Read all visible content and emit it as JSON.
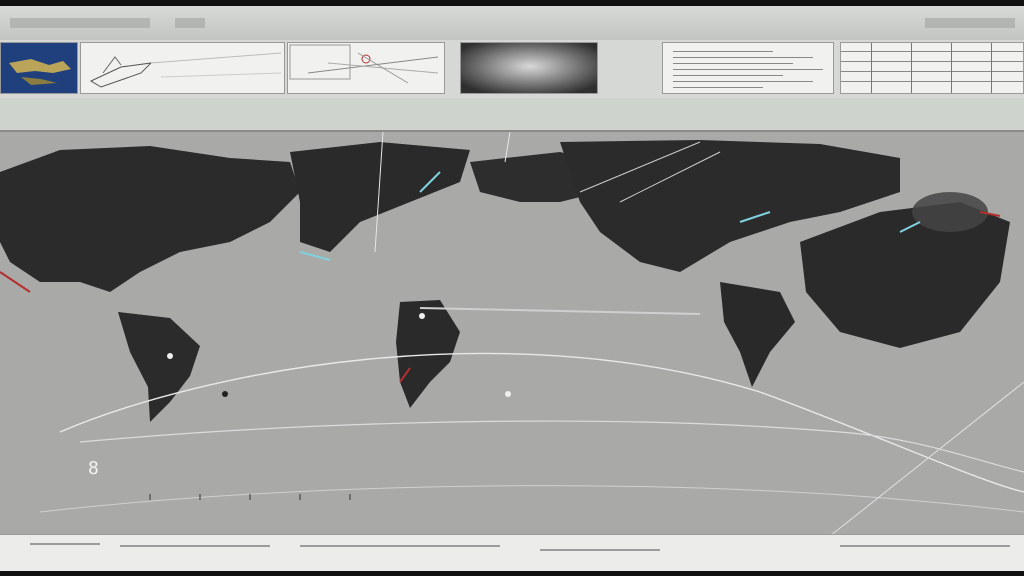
{
  "window": {
    "title": ""
  },
  "thumbnails": [
    {
      "name": "thumb-satellite-map"
    },
    {
      "name": "thumb-line-sketch"
    },
    {
      "name": "thumb-network-diagram"
    },
    {
      "name": "thumb-cloud-photo"
    },
    {
      "name": "thumb-text-document"
    },
    {
      "name": "thumb-data-table"
    }
  ],
  "map": {
    "marker_label": "8"
  },
  "colors": {
    "frame": "#c9cbc8",
    "map_background": "#a9a9a8",
    "landmass": "#2c2b2b",
    "route_line": "#e8e8e8",
    "accent_red": "#b33030",
    "accent_cyan": "#7fd1df"
  }
}
